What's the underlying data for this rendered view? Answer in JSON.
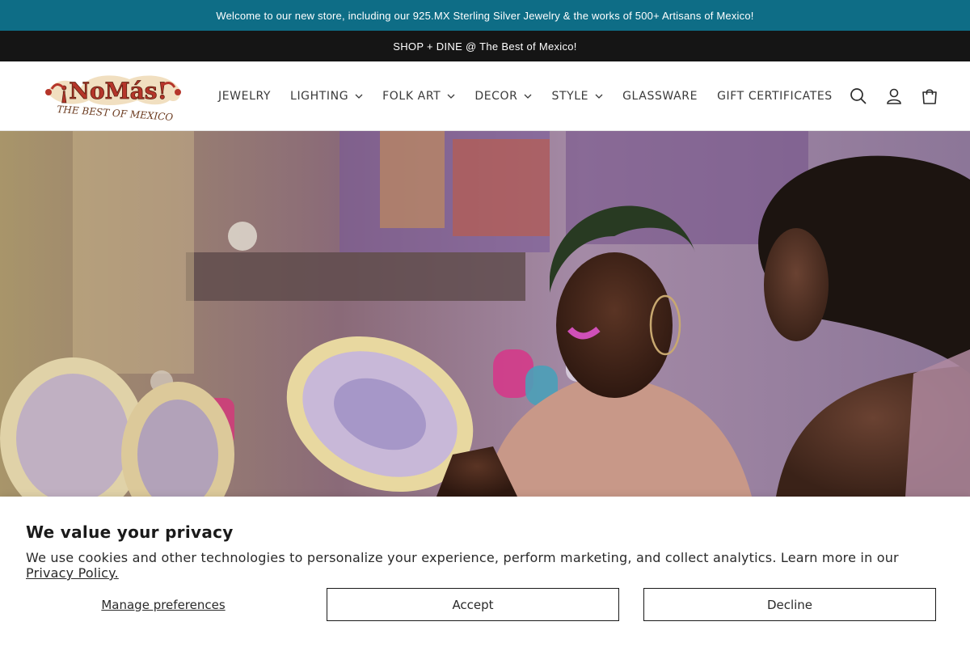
{
  "announcements": {
    "primary": "Welcome to our new store, including our 925.MX Sterling Silver Jewelry & the works of 500+ Artisans of Mexico!",
    "secondary": "SHOP + DINE @ The Best of Mexico!"
  },
  "brand": {
    "logo_name": "¡NoMás!",
    "logo_tagline": "THE BEST OF MEXICO",
    "colors": {
      "logo_red": "#b5352a",
      "logo_gold": "#d8a24a",
      "announce_teal": "#0e6d86",
      "announce_dark": "#151515"
    }
  },
  "nav": {
    "items": [
      {
        "label": "JEWELRY",
        "has_dropdown": false
      },
      {
        "label": "LIGHTING",
        "has_dropdown": true
      },
      {
        "label": "FOLK ART",
        "has_dropdown": true
      },
      {
        "label": "DECOR",
        "has_dropdown": true
      },
      {
        "label": "STYLE",
        "has_dropdown": true
      },
      {
        "label": "GLASSWARE",
        "has_dropdown": false
      },
      {
        "label": "GIFT CERTIFICATES",
        "has_dropdown": false
      }
    ],
    "icons": [
      "search-icon",
      "account-icon",
      "cart-icon"
    ]
  },
  "hero": {
    "description_icon": "video-still-two-women-with-painted-plates"
  },
  "privacy": {
    "title": "We value your privacy",
    "text": "We use cookies and other technologies to personalize your experience, perform marketing, and collect analytics. Learn more in our ",
    "link": "Privacy Policy.",
    "manage_label": "Manage preferences",
    "accept_label": "Accept",
    "decline_label": "Decline"
  }
}
